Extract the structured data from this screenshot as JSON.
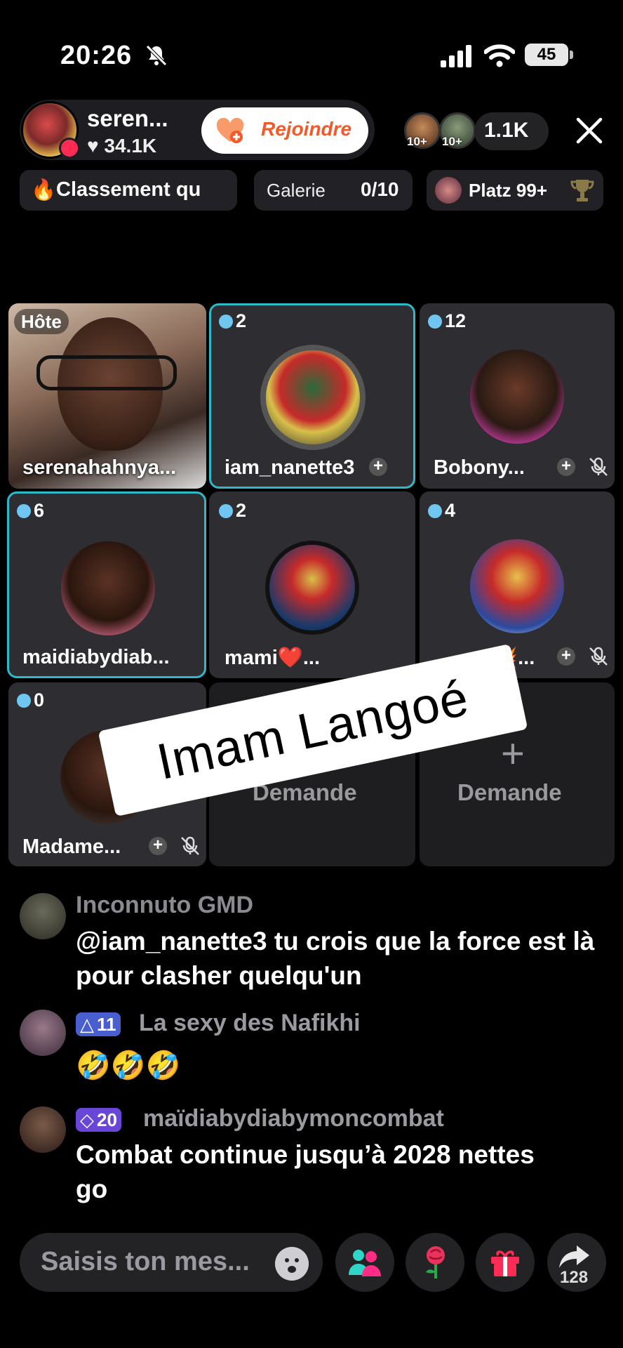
{
  "status_bar": {
    "time": "20:26",
    "battery": "45"
  },
  "host": {
    "name": "seren...",
    "likes": "34.1K",
    "join_label": "Rejoindre"
  },
  "viewers": {
    "badge": "10+",
    "count": "1.1K"
  },
  "chips": {
    "ranking": "Classement qu",
    "gallery_label": "Galerie",
    "gallery_count": "0/10",
    "platz": "Platz 99+"
  },
  "tiles": [
    {
      "badge": "Hôte",
      "name": "serenahahnya..."
    },
    {
      "badge": "2",
      "name": "iam_nanette3"
    },
    {
      "badge": "12",
      "name": "Bobony..."
    },
    {
      "badge": "6",
      "name": "maidiabydiab..."
    },
    {
      "badge": "2",
      "name": "mami❤️..."
    },
    {
      "badge": "4",
      "name": "💥..."
    },
    {
      "badge": "0",
      "name": "Madame..."
    },
    {
      "plus": "+",
      "label": "Demande"
    },
    {
      "plus": "+",
      "label": "Demande"
    }
  ],
  "overlay_text": "Imam Langoé",
  "comments": [
    {
      "user": "Inconnuto GMD",
      "text": "@iam_nanette3 tu crois que la force est là pour clasher quelqu'un"
    },
    {
      "level": "11",
      "user": "La sexy des Nafikhi",
      "text": "🤣🤣🤣"
    },
    {
      "level": "20",
      "user": "maïdiabydiabymoncombat",
      "text": "Combat continue jusqu’à 2028 nettes  go"
    }
  ],
  "input": {
    "placeholder": "Saisis ton mes..."
  },
  "share_count": "128",
  "colors": {
    "accent": "#fe2c55",
    "join_text": "#f25a2a",
    "highlight_border": "#2fb8c8",
    "gem": "#6fc6f0"
  }
}
